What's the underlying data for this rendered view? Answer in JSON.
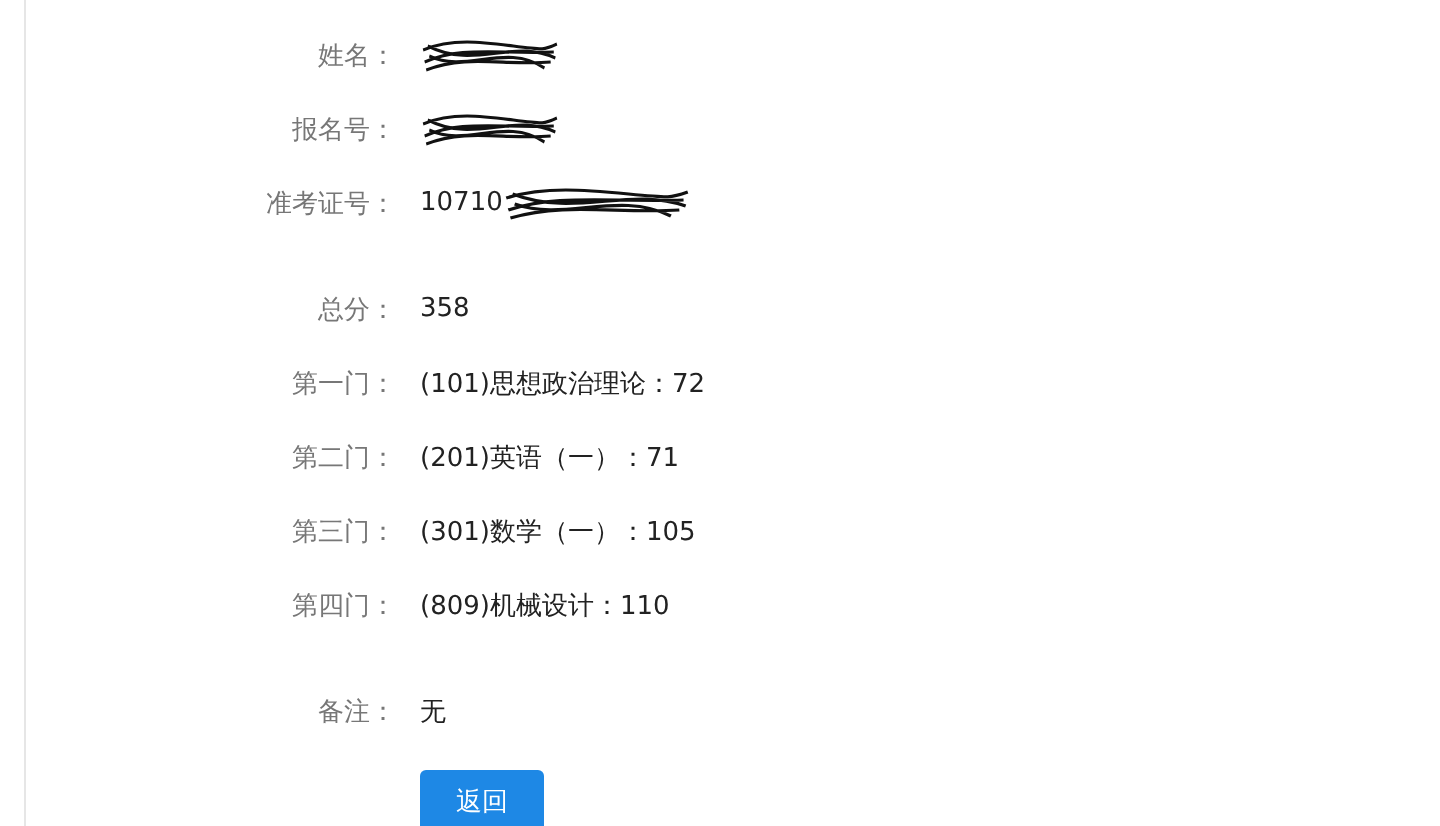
{
  "sections": [
    {
      "fields": [
        {
          "label": "姓名：",
          "redacted": true
        },
        {
          "label": "报名号：",
          "redacted": true
        },
        {
          "label": "准考证号：",
          "value": "10710",
          "redacted": true
        }
      ]
    },
    {
      "fields": [
        {
          "label": "总分：",
          "value": "358",
          "redacted": false
        },
        {
          "label": "第一门：",
          "value": "(101)思想政治理论：72",
          "redacted": false
        },
        {
          "label": "第二门：",
          "value": "(201)英语（一）：71",
          "redacted": false
        },
        {
          "label": "第三门：",
          "value": "(301)数学（一）：105",
          "redacted": false
        },
        {
          "label": "第四门：",
          "value": "(809)机械设计：110",
          "redacted": false
        }
      ]
    },
    {
      "fields": [
        {
          "label": "备注：",
          "value": "无",
          "redacted": false
        }
      ]
    }
  ],
  "back_button": "返回"
}
